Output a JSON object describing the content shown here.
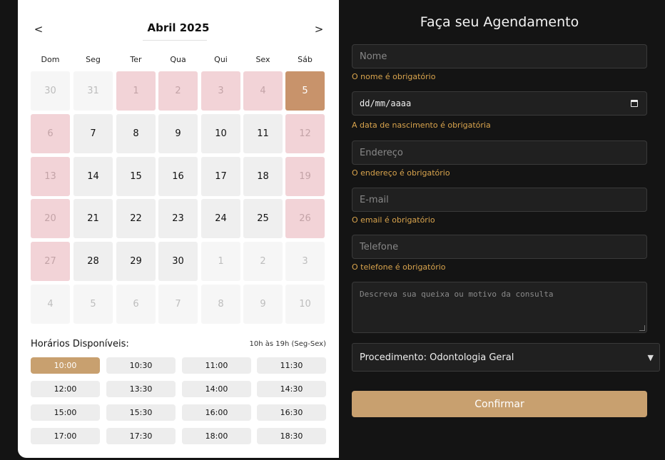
{
  "calendar": {
    "prev_icon": "<",
    "next_icon": ">",
    "month": "Abril 2025",
    "weekdays": [
      "Dom",
      "Seg",
      "Ter",
      "Qua",
      "Qui",
      "Sex",
      "Sáb"
    ],
    "days": [
      {
        "label": "30",
        "state": "out"
      },
      {
        "label": "31",
        "state": "out"
      },
      {
        "label": "1",
        "state": "unavail"
      },
      {
        "label": "2",
        "state": "unavail"
      },
      {
        "label": "3",
        "state": "unavail"
      },
      {
        "label": "4",
        "state": "unavail"
      },
      {
        "label": "5",
        "state": "selected"
      },
      {
        "label": "6",
        "state": "unavail"
      },
      {
        "label": "7",
        "state": "avail"
      },
      {
        "label": "8",
        "state": "avail"
      },
      {
        "label": "9",
        "state": "avail"
      },
      {
        "label": "10",
        "state": "avail"
      },
      {
        "label": "11",
        "state": "avail"
      },
      {
        "label": "12",
        "state": "unavail"
      },
      {
        "label": "13",
        "state": "unavail"
      },
      {
        "label": "14",
        "state": "avail"
      },
      {
        "label": "15",
        "state": "avail"
      },
      {
        "label": "16",
        "state": "avail"
      },
      {
        "label": "17",
        "state": "avail"
      },
      {
        "label": "18",
        "state": "avail"
      },
      {
        "label": "19",
        "state": "unavail"
      },
      {
        "label": "20",
        "state": "unavail"
      },
      {
        "label": "21",
        "state": "avail"
      },
      {
        "label": "22",
        "state": "avail"
      },
      {
        "label": "23",
        "state": "avail"
      },
      {
        "label": "24",
        "state": "avail"
      },
      {
        "label": "25",
        "state": "avail"
      },
      {
        "label": "26",
        "state": "unavail"
      },
      {
        "label": "27",
        "state": "unavail"
      },
      {
        "label": "28",
        "state": "avail"
      },
      {
        "label": "29",
        "state": "avail"
      },
      {
        "label": "30",
        "state": "avail"
      },
      {
        "label": "1",
        "state": "out"
      },
      {
        "label": "2",
        "state": "out"
      },
      {
        "label": "3",
        "state": "out"
      },
      {
        "label": "4",
        "state": "out"
      },
      {
        "label": "5",
        "state": "out"
      },
      {
        "label": "6",
        "state": "out"
      },
      {
        "label": "7",
        "state": "out"
      },
      {
        "label": "8",
        "state": "out"
      },
      {
        "label": "9",
        "state": "out"
      },
      {
        "label": "10",
        "state": "out"
      }
    ]
  },
  "hours": {
    "label": "Horários Disponíveis:",
    "note": "10h às 19h (Seg-Sex)",
    "slots": [
      "10:00",
      "10:30",
      "11:00",
      "11:30",
      "12:00",
      "13:30",
      "14:00",
      "14:30",
      "15:00",
      "15:30",
      "16:00",
      "16:30",
      "17:00",
      "17:30",
      "18:00",
      "18:30"
    ],
    "selected": "10:00"
  },
  "form": {
    "title": "Faça seu Agendamento",
    "name_placeholder": "Nome",
    "name_error": "O nome é obrigatório",
    "birth_value": "dd/mm/aaaa",
    "birth_error": "A data de nascimento é obrigatória",
    "address_placeholder": "Endereço",
    "address_error": "O endereço é obrigatório",
    "email_placeholder": "E-mail",
    "email_error": "O email é obrigatório",
    "phone_placeholder": "Telefone",
    "phone_error": "O telefone é obrigatório",
    "complaint_placeholder": "Descreva sua queixa ou motivo da consulta",
    "procedure_value": "Procedimento: Odontologia Geral",
    "confirm_label": "Confirmar"
  },
  "colors": {
    "selected_day": "#c8936b",
    "unavailable_day": "#f2d3d7",
    "accent": "#c8a06f",
    "error_text": "#d9a44d"
  },
  "icons": {
    "prev": "chevron-left-icon",
    "next": "chevron-right-icon",
    "date": "calendar-icon",
    "select": "caret-down-icon"
  }
}
